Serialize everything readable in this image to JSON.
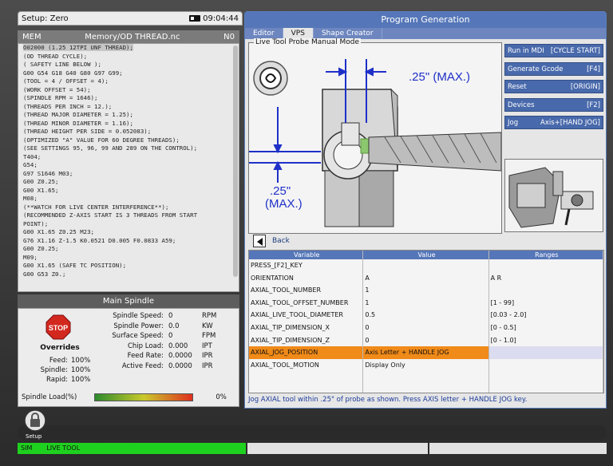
{
  "topbar": {
    "mode": "Setup: Zero",
    "time": "09:04:44"
  },
  "program": {
    "mode": "MEM",
    "file": "Memory/OD THREAD.nc",
    "n": "N0",
    "lines": [
      "O02000 (1.25 12TPI UNF THREAD);",
      "(OD THREAD CYCLE);",
      "( SAFETY LINE BELOW );",
      "G00 G54 G18 G40 G80 G97 G99;",
      "(TOOL = 4 / OFFSET = 4);",
      "(WORK OFFSET = 54);",
      "(SPINDLE RPM = 1646);",
      "(THREADS PER INCH = 12.);",
      "(THREAD MAJOR DIAMETER = 1.25);",
      "(THREAD MINOR DIAMETER = 1.16);",
      "(THREAD HEIGHT PER SIDE = 0.052083);",
      "(OPTIMIZED \"A\" VALUE FOR 60 DEGREE THREADS);",
      "(SEE SETTINGS 95, 96, 99 AND 289 ON THE CONTROL);",
      "T404;",
      "G54;",
      "G97 S1646 M03;",
      "G00 Z0.25;",
      "G00 X1.65;",
      "M08;",
      "(**WATCH FOR LIVE CENTER INTERFERENCE**);",
      "(RECOMMENDED Z-AXIS START IS 3 THREADS FROM START",
      "POINT);",
      "G00 X1.65 Z0.25 M23;",
      "G76 X1.16 Z-1.5 K0.0521 D0.005 F0.0833 A59;",
      "G00 Z0.25;",
      "M09;",
      "G00 X1.65 (SAFE TC POSITION);",
      "G00 G53 Z0.;"
    ]
  },
  "spindle": {
    "title": "Main Spindle",
    "overrides_label": "Overrides",
    "overrides": [
      {
        "label": "Feed:",
        "value": "100%"
      },
      {
        "label": "Spindle:",
        "value": "100%"
      },
      {
        "label": "Rapid:",
        "value": "100%"
      }
    ],
    "readouts": [
      {
        "label": "Spindle Speed:",
        "value": "0",
        "unit": "RPM"
      },
      {
        "label": "Spindle Power:",
        "value": "0.0",
        "unit": "KW"
      },
      {
        "label": "Surface Speed:",
        "value": "0",
        "unit": "FPM"
      },
      {
        "label": "Chip Load:",
        "value": "0.000",
        "unit": "IPT"
      },
      {
        "label": "Feed Rate:",
        "value": "0.0000",
        "unit": "IPR"
      },
      {
        "label": "Active Feed:",
        "value": "0.0000",
        "unit": "IPR"
      }
    ],
    "load_label": "Spindle Load(%)",
    "load_pct": "0%"
  },
  "panel": {
    "title": "Program Generation",
    "tabs": [
      "Editor",
      "VPS",
      "Shape Creator"
    ],
    "diagram_label": "Live Tool Probe Manual Mode",
    "dim_top": ".25\" (MAX.)",
    "dim_left_1": ".25\"",
    "dim_left_2": "(MAX.)",
    "actions": [
      {
        "label": "Run in MDI",
        "key": "[CYCLE START]"
      },
      {
        "label": "Generate Gcode",
        "key": "[F4]"
      },
      {
        "label": "Reset",
        "key": "[ORIGIN]"
      },
      {
        "label": "Devices",
        "key": "[F2]"
      },
      {
        "label": "Jog",
        "key": "Axis+[HAND JOG]"
      }
    ],
    "back_label": "Back",
    "table": {
      "headers": [
        "Variable",
        "Value",
        "Ranges"
      ],
      "rows": [
        [
          "PRESS_[F2]_KEY",
          "",
          ""
        ],
        [
          "ORIENTATION",
          "A",
          "A R"
        ],
        [
          "AXIAL_TOOL_NUMBER",
          "1",
          ""
        ],
        [
          "AXIAL_TOOL_OFFSET_NUMBER",
          "1",
          "[1 - 99]"
        ],
        [
          "AXIAL_LIVE_TOOL_DIAMETER",
          "0.5",
          "[0.03 - 2.0]"
        ],
        [
          "AXIAL_TIP_DIMENSION_X",
          "0",
          "[0 - 0.5]"
        ],
        [
          "AXIAL_TIP_DIMENSION_Z",
          "0",
          "[0 - 1.0]"
        ],
        [
          "AXIAL_JOG_POSITION",
          "Axis Letter + HANDLE JOG",
          ""
        ],
        [
          "AXIAL_TOOL_MOTION",
          "Display Only",
          ""
        ],
        [
          "",
          "",
          ""
        ],
        [
          "",
          "",
          ""
        ]
      ],
      "highlight_index": 7
    },
    "footer": "Jog AXIAL tool within .25\" of probe as shown. Press AXIS letter + HANDLE JOG key."
  },
  "bottom": {
    "setup_label": "Setup",
    "status_sim": "SIM",
    "status_tool": "LIVE TOOL"
  },
  "colors": {
    "accent": "#5576b8",
    "highlight": "#f08a18",
    "status_green": "#1fd11f"
  }
}
